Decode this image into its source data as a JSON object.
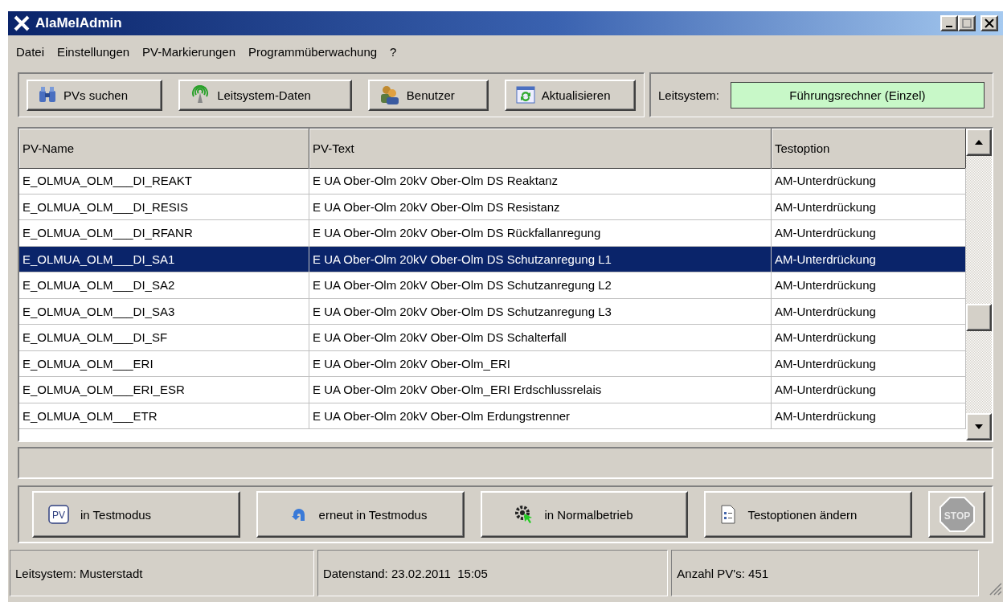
{
  "window": {
    "title": "AlaMelAdmin"
  },
  "menu": [
    "Datei",
    "Einstellungen",
    "PV-Markierungen",
    "Programmüberwachung",
    "?"
  ],
  "toolbar": [
    {
      "label": "PVs suchen",
      "kind": "binoculars"
    },
    {
      "label": "Leitsystem-Daten",
      "kind": "antenna"
    },
    {
      "label": "Benutzer",
      "kind": "users"
    },
    {
      "label": "Aktualisieren",
      "kind": "refresh"
    }
  ],
  "leitsystem": {
    "label": "Leitsystem:",
    "value": "Führungsrechner (Einzel)"
  },
  "table": {
    "columns": [
      "PV-Name",
      "PV-Text",
      "Testoption"
    ],
    "rows": [
      {
        "cells": [
          "E_OLMUA_OLM___DI_REAKT",
          "E UA Ober-Olm 20kV Ober-Olm DS Reaktanz",
          "AM-Unterdrückung"
        ],
        "selected": false
      },
      {
        "cells": [
          "E_OLMUA_OLM___DI_RESIS",
          "E UA Ober-Olm 20kV Ober-Olm DS Resistanz",
          "AM-Unterdrückung"
        ],
        "selected": false
      },
      {
        "cells": [
          "E_OLMUA_OLM___DI_RFANR",
          "E UA Ober-Olm 20kV Ober-Olm DS Rückfallanregung",
          "AM-Unterdrückung"
        ],
        "selected": false
      },
      {
        "cells": [
          "E_OLMUA_OLM___DI_SA1",
          "E UA Ober-Olm 20kV Ober-Olm DS Schutzanregung L1",
          "AM-Unterdrückung"
        ],
        "selected": true
      },
      {
        "cells": [
          "E_OLMUA_OLM___DI_SA2",
          "E UA Ober-Olm 20kV Ober-Olm DS Schutzanregung L2",
          "AM-Unterdrückung"
        ],
        "selected": false
      },
      {
        "cells": [
          "E_OLMUA_OLM___DI_SA3",
          "E UA Ober-Olm 20kV Ober-Olm DS Schutzanregung L3",
          "AM-Unterdrückung"
        ],
        "selected": false
      },
      {
        "cells": [
          "E_OLMUA_OLM___DI_SF",
          "E UA Ober-Olm 20kV Ober-Olm DS Schalterfall",
          "AM-Unterdrückung"
        ],
        "selected": false
      },
      {
        "cells": [
          "E_OLMUA_OLM___ERI",
          "E UA Ober-Olm 20kV Ober-Olm_ERI",
          "AM-Unterdrückung"
        ],
        "selected": false
      },
      {
        "cells": [
          "E_OLMUA_OLM___ERI_ESR",
          "E UA Ober-Olm 20kV Ober-Olm_ERI Erdschlussrelais",
          "AM-Unterdrückung"
        ],
        "selected": false
      },
      {
        "cells": [
          "E_OLMUA_OLM___ETR",
          "E UA Ober-Olm 20kV Ober-Olm Erdungstrenner",
          "AM-Unterdrückung"
        ],
        "selected": false
      }
    ]
  },
  "actions": [
    {
      "label": "in Testmodus",
      "kind": "pv",
      "icon_text": "PV"
    },
    {
      "label": "erneut in Testmodus",
      "kind": "arrow"
    },
    {
      "label": "in Normalbetrieb",
      "kind": "gear"
    },
    {
      "label": "Testoptionen ändern",
      "kind": "sheet"
    },
    {
      "kind": "stop",
      "icon_text": "STOP"
    }
  ],
  "status_bar": [
    "Leitsystem: Musterstadt",
    "Datenstand: 23.02.2011  15:05",
    "Anzahl PV's: 451"
  ]
}
